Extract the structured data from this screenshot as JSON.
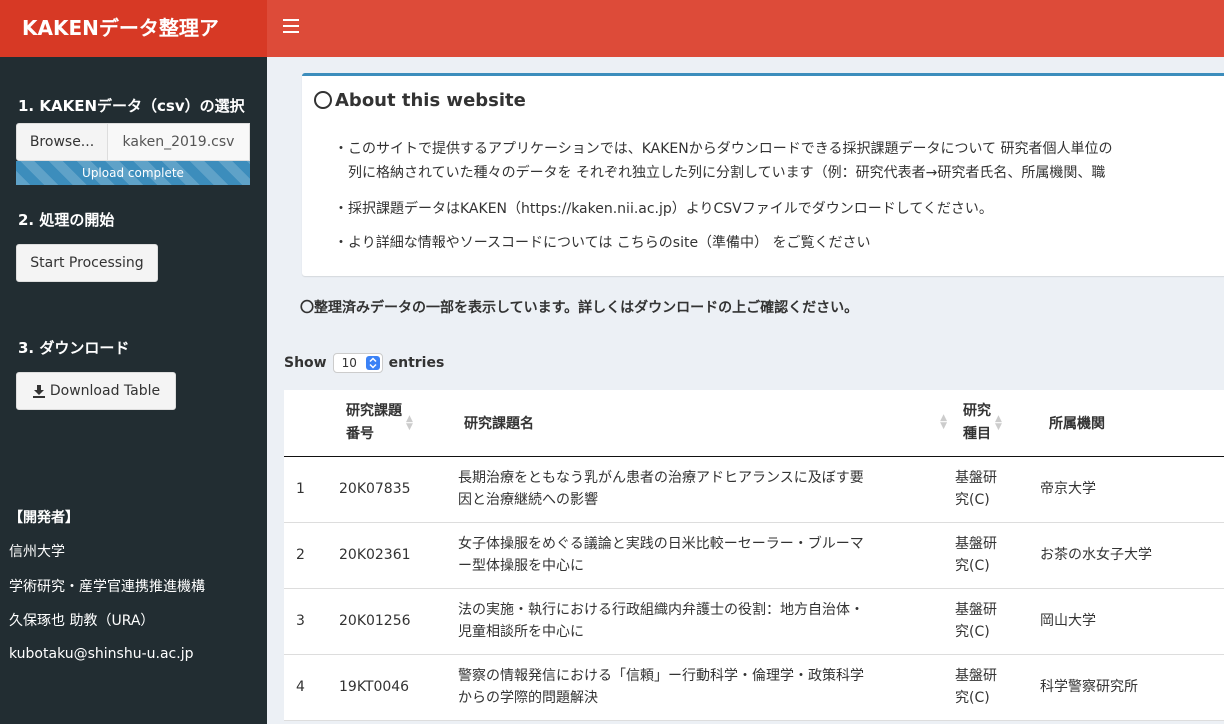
{
  "app": {
    "title": "KAKENデータ整理ア"
  },
  "sidebar": {
    "step1_label": "1. KAKENデータ（csv）の選択",
    "browse_label": "Browse...",
    "file_name": "kaken_2019.csv",
    "upload_status": "Upload complete",
    "step2_label": "2. 処理の開始",
    "start_label": "Start Processing",
    "step3_label": "3. ダウンロード",
    "download_label": "Download Table",
    "developer": {
      "heading": "【開発者】",
      "org1": "信州大学",
      "org2": "学術研究・産学官連携推進機構",
      "name": "久保琢也 助教（URA）",
      "email": "kubotaku@shinshu-u.ac.jp"
    }
  },
  "about": {
    "title": "About this website",
    "line1": "・このサイトで提供するアプリケーションでは、KAKENからダウンロードできる採択課題データについて 研究者個人単位の",
    "line2": "列に格納されていた種々のデータを それぞれ独立した列に分割しています（例：研究代表者→研究者氏名、所属機関、職",
    "line3": "・採択課題データはKAKEN（https://kaken.nii.ac.jp）よりCSVファイルでダウンロードしてください。",
    "line4": "・より詳細な情報やソースコードについては こちらのsite（準備中） をご覧ください"
  },
  "notice": "〇整理済みデータの一部を表示しています。詳しくはダウンロードの上ご確認ください。",
  "table": {
    "show_label": "Show",
    "entries_value": "10",
    "entries_label": "entries",
    "headers": {
      "col2a": "研究課題",
      "col2b": "番号",
      "col3": "研究課題名",
      "col4a": "研究",
      "col4b": "種目",
      "col5": "所属機関"
    },
    "rows": [
      {
        "idx": "1",
        "id": "20K07835",
        "title1": "長期治療をともなう乳がん患者の治療アドヒアランスに及ぼす要",
        "title2": "因と治療継続への影響",
        "type1": "基盤研",
        "type2": "究(C)",
        "inst": "帝京大学"
      },
      {
        "idx": "2",
        "id": "20K02361",
        "title1": "女子体操服をめぐる議論と実践の日米比較ーセーラー・ブルーマ",
        "title2": "ー型体操服を中心に",
        "type1": "基盤研",
        "type2": "究(C)",
        "inst": "お茶の水女子大学"
      },
      {
        "idx": "3",
        "id": "20K01256",
        "title1": "法の実施・執行における行政組織内弁護士の役割：地方自治体・",
        "title2": "児童相談所を中心に",
        "type1": "基盤研",
        "type2": "究(C)",
        "inst": "岡山大学"
      },
      {
        "idx": "4",
        "id": "19KT0046",
        "title1": "警察の情報発信における「信頼」ー行動科学・倫理学・政策科学",
        "title2": "からの学際的問題解決",
        "type1": "基盤研",
        "type2": "究(C)",
        "inst": "科学警察研究所"
      }
    ]
  }
}
